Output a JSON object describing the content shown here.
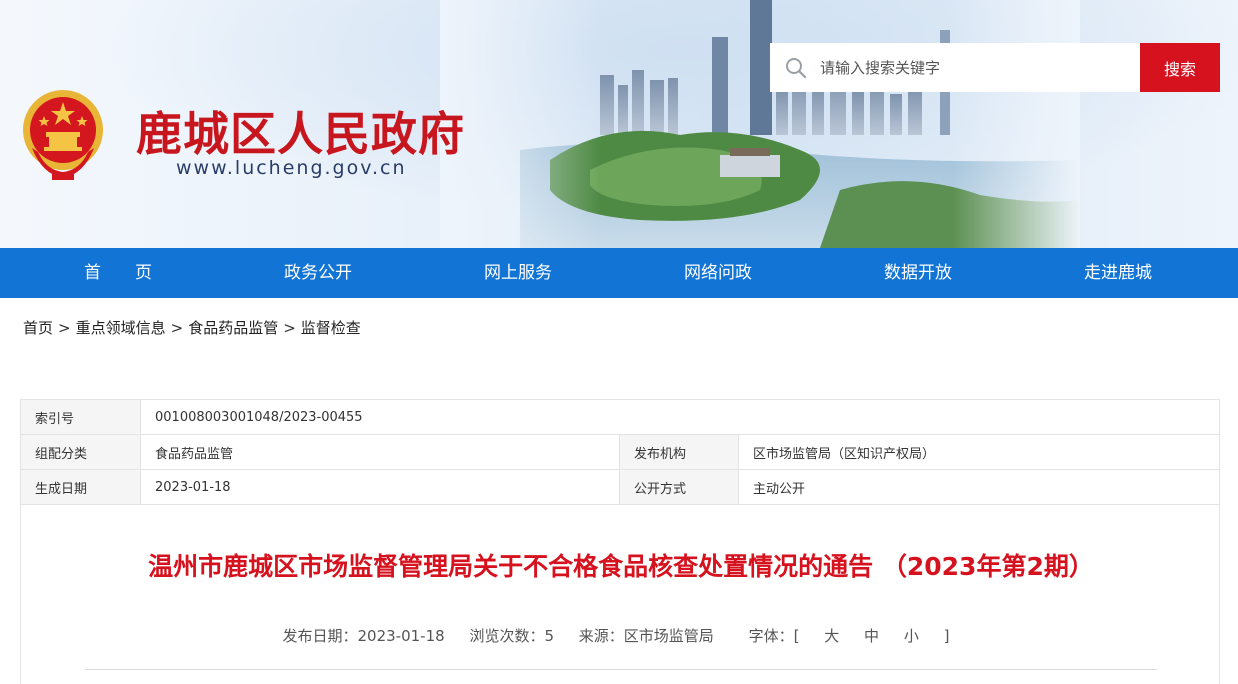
{
  "header": {
    "site_title": "鹿城区人民政府",
    "site_url": "www.lucheng.gov.cn",
    "search_placeholder": "请输入搜索关键字",
    "search_button": "搜索"
  },
  "nav": {
    "items": [
      "首　　页",
      "政务公开",
      "网上服务",
      "网络问政",
      "数据开放",
      "走进鹿城"
    ]
  },
  "breadcrumb": {
    "items": [
      "首页",
      "重点领域信息",
      "食品药品监管",
      "监督检查"
    ],
    "separator": ">"
  },
  "info": {
    "index_label": "索引号",
    "index_value": "001008003001048/2023-00455",
    "category_label": "组配分类",
    "category_value": "食品药品监管",
    "org_label": "发布机构",
    "org_value": "区市场监管局（区知识产权局）",
    "date_label": "生成日期",
    "date_value": "2023-01-18",
    "mode_label": "公开方式",
    "mode_value": "主动公开"
  },
  "article": {
    "title": "温州市鹿城区市场监督管理局关于不合格食品核查处置情况的通告 （2023年第2期）",
    "publish_date": "发布日期：2023-01-18",
    "views": "浏览次数：5",
    "source": "来源：区市场监管局",
    "font_label": "字体：[",
    "font_large": "大",
    "font_medium": "中",
    "font_small": "小",
    "font_close": "]"
  },
  "colors": {
    "brand_red": "#d6121f",
    "nav_blue": "#1275d6"
  }
}
